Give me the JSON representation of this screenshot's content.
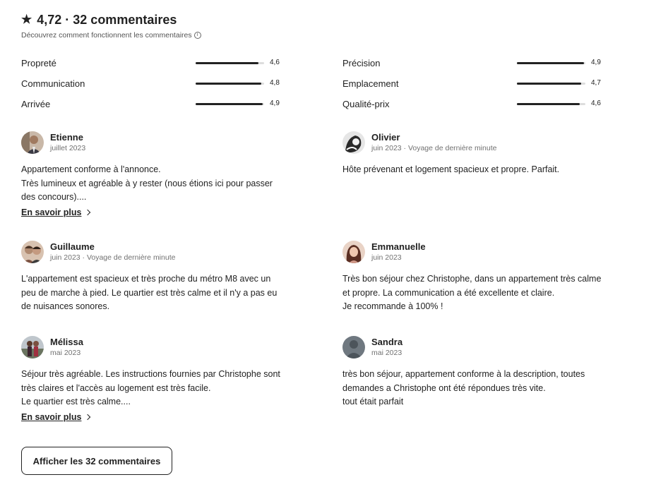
{
  "header": {
    "star_icon": "star-icon",
    "title": "4,72 · 32 commentaires",
    "subtitle": "Découvrez comment fonctionnent les commentaires"
  },
  "ratings": {
    "left": [
      {
        "label": "Propreté",
        "value": "4,6",
        "score": 4.6
      },
      {
        "label": "Communication",
        "value": "4,8",
        "score": 4.8
      },
      {
        "label": "Arrivée",
        "value": "4,9",
        "score": 4.9
      }
    ],
    "right": [
      {
        "label": "Précision",
        "value": "4,9",
        "score": 4.9
      },
      {
        "label": "Emplacement",
        "value": "4,7",
        "score": 4.7
      },
      {
        "label": "Qualité-prix",
        "value": "4,6",
        "score": 4.6
      }
    ]
  },
  "reviews": [
    {
      "name": "Etienne",
      "date": "juillet 2023",
      "text": "Appartement conforme à l'annonce.\nTrès lumineux et agréable à y rester (nous étions ici pour passer des concours)....",
      "more": "En savoir plus"
    },
    {
      "name": "Olivier",
      "date": "juin 2023 · Voyage de dernière minute",
      "text": "Hôte prévenant et logement spacieux et propre. Parfait."
    },
    {
      "name": "Guillaume",
      "date": "juin 2023 · Voyage de dernière minute",
      "text": "L'appartement est spacieux et très proche du métro M8 avec un peu de marche à pied. Le quartier est très calme et il n'y a pas eu de nuisances sonores."
    },
    {
      "name": "Emmanuelle",
      "date": "juin 2023",
      "text": "Très bon séjour chez Christophe, dans un appartement très calme et propre. La communication a été excellente et claire.\nJe recommande à 100% !"
    },
    {
      "name": "Mélissa",
      "date": "mai 2023",
      "text": "Séjour très agréable. Les instructions fournies par Christophe sont très claires et l'accès au logement est très facile.\nLe quartier est très calme....",
      "more": "En savoir plus"
    },
    {
      "name": "Sandra",
      "date": "mai 2023",
      "text": "très bon séjour, appartement conforme à la description, toutes demandes a Christophe ont été répondues très vite.\ntout était parfait"
    }
  ],
  "show_all_button": "Afficher les 32 commentaires",
  "colors": {
    "text": "#222222",
    "muted": "#717171",
    "bar": "#222222",
    "track": "#dddddd"
  }
}
